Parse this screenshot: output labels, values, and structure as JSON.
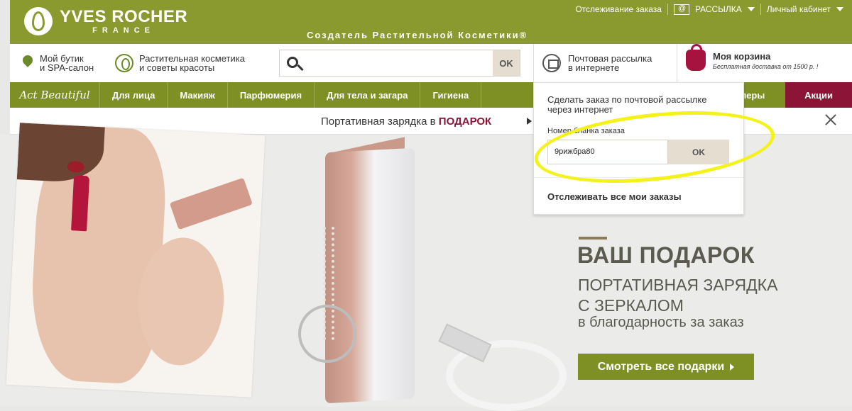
{
  "header": {
    "brand": "YVES ROCHER",
    "country": "FRANCE",
    "tagline": "Создатель Растительной Косметики®",
    "track_order": "Отслеживание заказа",
    "newsletter": "РАССЫЛКА",
    "account": "Личный кабинет"
  },
  "subbar": {
    "boutique": "Мой бутик\nи SPA-салон",
    "boutique_l1": "Мой бутик",
    "boutique_l2": "и SPA-салон",
    "cosmetics_l1": "Растительная косметика",
    "cosmetics_l2": "и советы красоты",
    "search_ok": "OK",
    "mail_l1": "Почтовая рассылка",
    "mail_l2": "в интернете",
    "cart_title": "Моя корзина",
    "cart_sub": "Бесплатная доставка от 1500 р. !"
  },
  "nav": {
    "logo": "Act Beautiful",
    "items": [
      "Для лица",
      "Макияж",
      "Парфюмерия",
      "Для тела и загара",
      "Гигиена"
    ],
    "tail": "леры",
    "sale": "Акции"
  },
  "promo": {
    "text": "Портативная зарядка в ",
    "highlight": "ПОДАРОК"
  },
  "dropdown": {
    "title": "Сделать заказ по почтовой рассылке через интернет",
    "label": "Номер бланка заказа",
    "value": "9рижбра80",
    "ok": "OK",
    "track_all": "Отслеживать все мои заказы"
  },
  "hero": {
    "title": "ВАШ ПОДАРОК",
    "sub_l1": "ПОРТАТИВНАЯ ЗАРЯДКА",
    "sub_l2": "С ЗЕРКАЛОМ",
    "thanks": "в благодарность за заказ",
    "button": "Смотреть все подарки"
  },
  "colors": {
    "brand_green": "#8a9a2e",
    "nav_green": "#7e8f24",
    "sale_red": "#8c1436",
    "highlight_yellow": "#f3f219"
  }
}
